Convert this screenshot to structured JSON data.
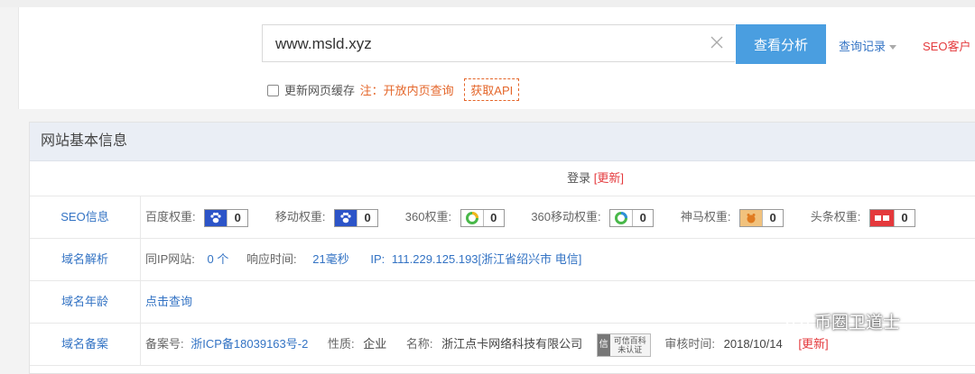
{
  "search": {
    "value": "www.msld.xyz",
    "button_label": "查看分析",
    "history_label": "查询记录",
    "seo_label": "SEO客户"
  },
  "options": {
    "cache_label": "更新网页缓存",
    "note_text": "注：开放内页查询",
    "api_label": "获取API"
  },
  "panel": {
    "title": "网站基本信息",
    "login_text": "登录",
    "login_update": "[更新]",
    "seo": {
      "label": "SEO信息",
      "weights": [
        {
          "name": "百度权重:",
          "value": "0",
          "icon": "baidu-paw-icon"
        },
        {
          "name": "移动权重:",
          "value": "0",
          "icon": "baidu-paw-icon"
        },
        {
          "name": "360权重:",
          "value": "0",
          "icon": "360-ring-icon"
        },
        {
          "name": "360移动权重:",
          "value": "0",
          "icon": "360-ring-icon"
        },
        {
          "name": "神马权重:",
          "value": "0",
          "icon": "shenma-icon"
        },
        {
          "name": "头条权重:",
          "value": "0",
          "icon": "toutiao-icon"
        }
      ]
    },
    "dns": {
      "label": "域名解析",
      "same_ip_label": "同IP网站:",
      "same_ip_value": "0 个",
      "response_label": "响应时间:",
      "response_value": "21毫秒",
      "ip_label": "IP:",
      "ip_value": "111.229.125.193[浙江省绍兴市 电信]"
    },
    "age": {
      "label": "域名年龄",
      "link": "点击查询"
    },
    "icp": {
      "label": "域名备案",
      "no_label": "备案号:",
      "no_value": "浙ICP备18039163号-2",
      "type_label": "性质:",
      "type_value": "企业",
      "name_label": "名称:",
      "name_value": "浙江点卡网络科技有限公司",
      "cert_icon_text": "信",
      "cert_line1": "可信百科",
      "cert_line2": "未认证",
      "audit_label": "审核时间:",
      "audit_value": "2018/10/14",
      "update": "[更新]"
    }
  },
  "watermark": "币圈卫道士",
  "colors": {
    "accent_blue": "#4a9ee0",
    "link_blue": "#3373c4",
    "red": "#e4393c",
    "orange": "#e4662a"
  }
}
